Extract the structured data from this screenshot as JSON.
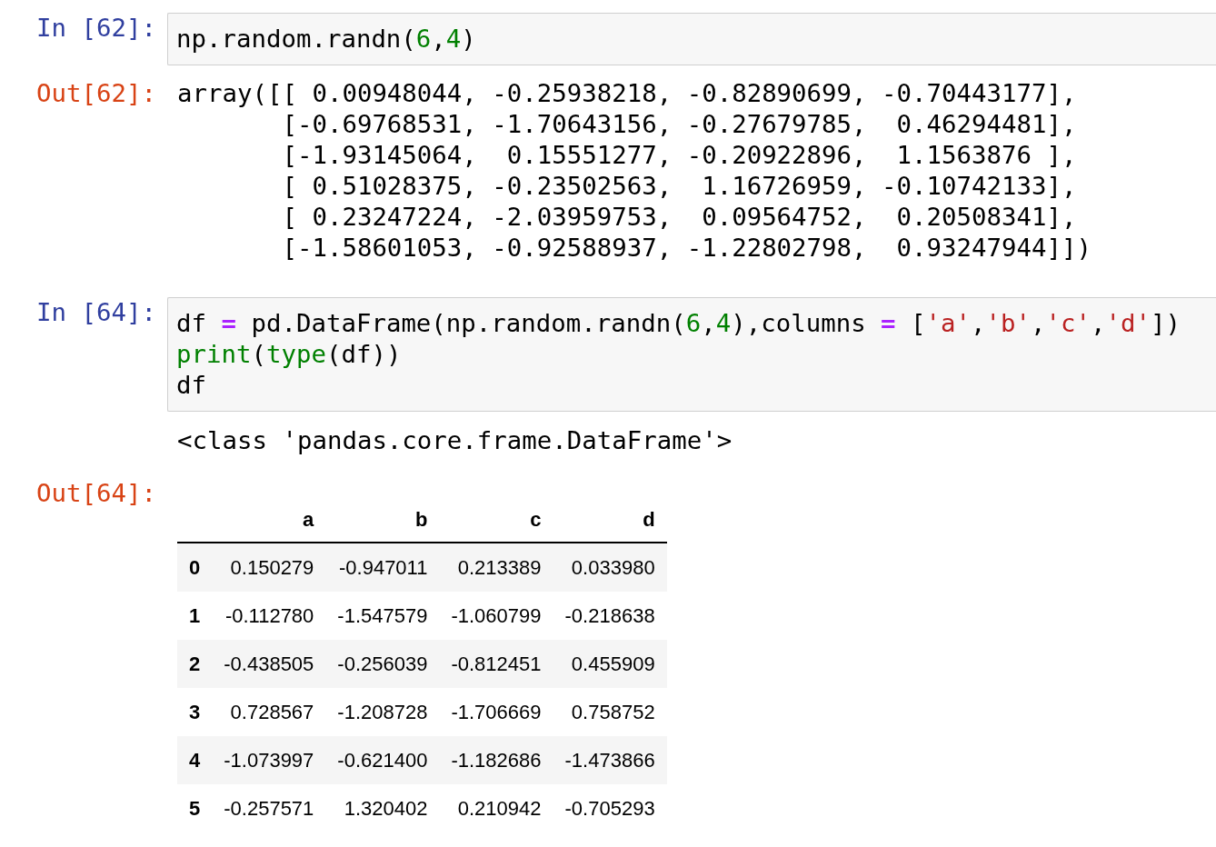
{
  "cells": [
    {
      "kind": "input",
      "prompt": "In [62]:",
      "lines": [
        [
          {
            "kind": "plain",
            "text": "np.random.randn("
          },
          {
            "kind": "number",
            "text": "6"
          },
          {
            "kind": "plain",
            "text": ","
          },
          {
            "kind": "number",
            "text": "4"
          },
          {
            "kind": "plain",
            "text": ")"
          }
        ]
      ]
    },
    {
      "kind": "output",
      "prompt": "Out[62]:",
      "text_lines": [
        "array([[ 0.00948044, -0.25938218, -0.82890699, -0.70443177],",
        "       [-0.69768531, -1.70643156, -0.27679785,  0.46294481],",
        "       [-1.93145064,  0.15551277, -0.20922896,  1.1563876 ],",
        "       [ 0.51028375, -0.23502563,  1.16726959, -0.10742133],",
        "       [ 0.23247224, -2.03959753,  0.09564752,  0.20508341],",
        "       [-1.58601053, -0.92588937, -1.22802798,  0.93247944]])"
      ]
    },
    {
      "kind": "input",
      "prompt": "In [64]:",
      "lines": [
        [
          {
            "kind": "plain",
            "text": "df "
          },
          {
            "kind": "operator",
            "text": "="
          },
          {
            "kind": "plain",
            "text": " pd.DataFrame(np.random.randn("
          },
          {
            "kind": "number",
            "text": "6"
          },
          {
            "kind": "plain",
            "text": ","
          },
          {
            "kind": "number",
            "text": "4"
          },
          {
            "kind": "plain",
            "text": "),columns "
          },
          {
            "kind": "operator",
            "text": "="
          },
          {
            "kind": "plain",
            "text": " ["
          },
          {
            "kind": "string",
            "text": "'a'"
          },
          {
            "kind": "plain",
            "text": ","
          },
          {
            "kind": "string",
            "text": "'b'"
          },
          {
            "kind": "plain",
            "text": ","
          },
          {
            "kind": "string",
            "text": "'c'"
          },
          {
            "kind": "plain",
            "text": ","
          },
          {
            "kind": "string",
            "text": "'d'"
          },
          {
            "kind": "plain",
            "text": "])"
          }
        ],
        [
          {
            "kind": "builtin",
            "text": "print"
          },
          {
            "kind": "plain",
            "text": "("
          },
          {
            "kind": "builtin",
            "text": "type"
          },
          {
            "kind": "plain",
            "text": "(df))"
          }
        ],
        [
          {
            "kind": "plain",
            "text": "df"
          }
        ]
      ]
    },
    {
      "kind": "stream",
      "text_lines": [
        "<class 'pandas.core.frame.DataFrame'>"
      ]
    },
    {
      "kind": "table",
      "prompt": "Out[64]:",
      "columns": [
        "a",
        "b",
        "c",
        "d"
      ],
      "rows": [
        {
          "index": "0",
          "values": [
            "0.150279",
            "-0.947011",
            "0.213389",
            "0.033980"
          ]
        },
        {
          "index": "1",
          "values": [
            "-0.112780",
            "-1.547579",
            "-1.060799",
            "-0.218638"
          ]
        },
        {
          "index": "2",
          "values": [
            "-0.438505",
            "-0.256039",
            "-0.812451",
            "0.455909"
          ]
        },
        {
          "index": "3",
          "values": [
            "0.728567",
            "-1.208728",
            "-1.706669",
            "0.758752"
          ]
        },
        {
          "index": "4",
          "values": [
            "-1.073997",
            "-0.621400",
            "-1.182686",
            "-1.473866"
          ]
        },
        {
          "index": "5",
          "values": [
            "-0.257571",
            "1.320402",
            "0.210942",
            "-0.705293"
          ]
        }
      ]
    }
  ]
}
